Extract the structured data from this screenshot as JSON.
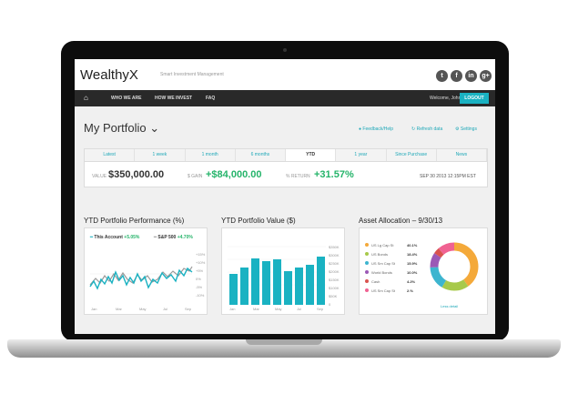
{
  "header": {
    "logo": "WealthyX",
    "tagline": "Smart Investment Management",
    "social": [
      "t",
      "f",
      "in",
      "g+"
    ]
  },
  "nav": {
    "links": [
      "WHO WE ARE",
      "HOW WE INVEST",
      "FAQ"
    ],
    "welcome": "Welcome, John",
    "logout": "LOGOUT"
  },
  "page": {
    "title": "My Portfolio",
    "links": [
      "Feedback/Help",
      "Refresh data",
      "Settings"
    ]
  },
  "tabs": [
    "Latest",
    "1 week",
    "1 month",
    "6 months",
    "YTD",
    "1 year",
    "Since Purchase",
    "News"
  ],
  "summary": {
    "value_label": "VALUE",
    "value": "$350,000.00",
    "gain_label": "$ GAIN",
    "gain": "+$84,000.00",
    "return_label": "% RETURN",
    "return": "+31.57%",
    "as_of": "SEP 30 2013 12:15PM EST"
  },
  "performance": {
    "title": "YTD Portfolio Performance (%)",
    "account_label": "This Account",
    "account_value": "+5.05%",
    "sp_label": "S&P 500",
    "sp_value": "+4.70%",
    "account_color": "#1ab2c2",
    "sp_color": "#9a9a9a",
    "x_labels": [
      "Jan",
      "Mar",
      "May",
      "Jul",
      "Sep"
    ],
    "y_labels": [
      "+15%",
      "+10%",
      "+5%",
      "0%",
      "-5%",
      "-10%"
    ]
  },
  "value_chart": {
    "title": "YTD Portfolio Value ($)",
    "bar_color": "#1ab2c2",
    "x_labels": [
      "Jan",
      "Mar",
      "May",
      "Jul",
      "Sep"
    ],
    "y_labels": [
      "$350K",
      "$300K",
      "$250K",
      "$200K",
      "$150K",
      "$100K",
      "$50K",
      "0"
    ]
  },
  "allocation": {
    "title": "Asset Allocation – 9/30/13",
    "link": "Less detail",
    "items": [
      {
        "label": "US Lg Cap St",
        "value": "40.1%",
        "color": "#f4a93a"
      },
      {
        "label": "US Bonds",
        "value": "18.4%",
        "color": "#a7c94a"
      },
      {
        "label": "US Sm Cap St",
        "value": "15.9%",
        "color": "#3db5cf"
      },
      {
        "label": "World Bonds",
        "value": "10.0%",
        "color": "#9b59b6"
      },
      {
        "label": "Cash",
        "value": "4.2%",
        "color": "#d9534f"
      },
      {
        "label": "US Sm Cap St",
        "value": "2.%",
        "color": "#f06292"
      }
    ]
  }
}
